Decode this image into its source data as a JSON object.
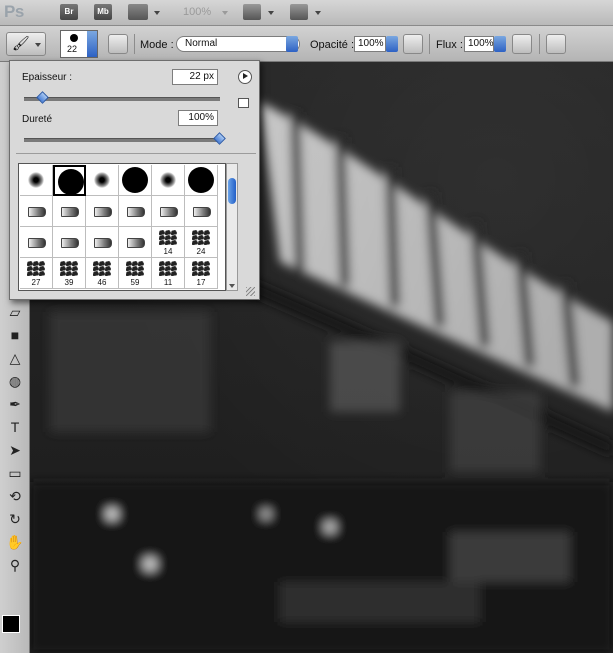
{
  "app": {
    "logo": "Ps",
    "bridge_label": "Br",
    "minibridge_label": "Mb",
    "zoom": "100%"
  },
  "options": {
    "brush_size": "22",
    "mode_label": "Mode :",
    "mode_value": "Normal",
    "opacity_label": "Opacité :",
    "opacity_value": "100%",
    "flow_label": "Flux :",
    "flow_value": "100%"
  },
  "brush_panel": {
    "size_label": "Epaisseur :",
    "size_value": "22 px",
    "size_slider_fraction": 0.09,
    "hardness_label": "Dureté",
    "hardness_value": "100%",
    "hardness_slider_fraction": 1.0,
    "presets": [
      {
        "kind": "soft-round",
        "label": ""
      },
      {
        "kind": "hard-round",
        "label": ""
      },
      {
        "kind": "soft-round",
        "label": ""
      },
      {
        "kind": "hard-round",
        "label": ""
      },
      {
        "kind": "soft-round",
        "label": ""
      },
      {
        "kind": "hard-round",
        "label": ""
      },
      {
        "kind": "tip",
        "label": ""
      },
      {
        "kind": "tip",
        "label": ""
      },
      {
        "kind": "tip",
        "label": ""
      },
      {
        "kind": "tip",
        "label": ""
      },
      {
        "kind": "tip",
        "label": ""
      },
      {
        "kind": "tip",
        "label": ""
      },
      {
        "kind": "tip",
        "label": ""
      },
      {
        "kind": "tip",
        "label": ""
      },
      {
        "kind": "tip",
        "label": ""
      },
      {
        "kind": "tip",
        "label": ""
      },
      {
        "kind": "scatter",
        "label": "14"
      },
      {
        "kind": "scatter",
        "label": "24"
      },
      {
        "kind": "scatter",
        "label": "27"
      },
      {
        "kind": "scatter",
        "label": "39"
      },
      {
        "kind": "scatter",
        "label": "46"
      },
      {
        "kind": "scatter",
        "label": "59"
      },
      {
        "kind": "scatter",
        "label": "11"
      },
      {
        "kind": "scatter",
        "label": "17"
      }
    ]
  },
  "tools": [
    {
      "name": "eraser-icon",
      "glyph": "▱"
    },
    {
      "name": "gradient-icon",
      "glyph": "■"
    },
    {
      "name": "blur-icon",
      "glyph": "△"
    },
    {
      "name": "dodge-icon",
      "glyph": "◍"
    },
    {
      "name": "pen-icon",
      "glyph": "✒"
    },
    {
      "name": "type-icon",
      "glyph": "T"
    },
    {
      "name": "path-selection-icon",
      "glyph": "➤"
    },
    {
      "name": "rectangle-icon",
      "glyph": "▭"
    },
    {
      "name": "3d-rotate-icon",
      "glyph": "⟲"
    },
    {
      "name": "3d-orbit-icon",
      "glyph": "↻"
    },
    {
      "name": "hand-icon",
      "glyph": "✋"
    },
    {
      "name": "zoom-icon",
      "glyph": "⚲"
    }
  ]
}
